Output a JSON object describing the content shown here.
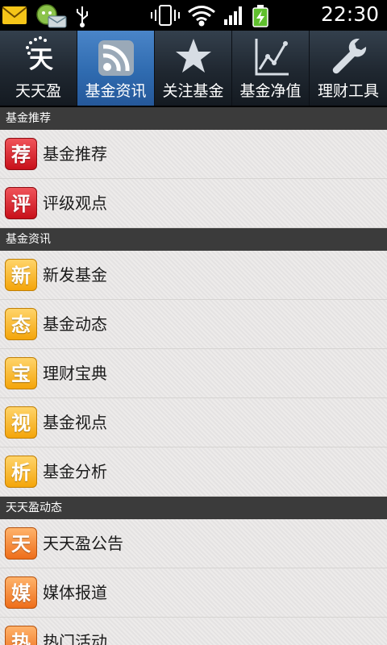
{
  "status_bar": {
    "time": "22:30",
    "left_icons": [
      "mail-icon",
      "chat-notification-icon",
      "usb-icon"
    ],
    "right_icons": [
      "vibrate-icon",
      "wifi-icon",
      "signal-icon",
      "battery-charging-icon"
    ]
  },
  "tabs": [
    {
      "label": "天天盈",
      "icon": "tiantianying-logo-icon",
      "selected": false
    },
    {
      "label": "基金资讯",
      "icon": "rss-feed-icon",
      "selected": true
    },
    {
      "label": "关注基金",
      "icon": "star-icon",
      "selected": false
    },
    {
      "label": "基金净值",
      "icon": "line-chart-icon",
      "selected": false
    },
    {
      "label": "理财工具",
      "icon": "wrench-icon",
      "selected": false
    }
  ],
  "tab_logo_char": "天",
  "sections": [
    {
      "title": "基金推荐",
      "items": [
        {
          "icon_char": "荐",
          "label": "基金推荐",
          "color": "red"
        },
        {
          "icon_char": "评",
          "label": "评级观点",
          "color": "red"
        }
      ]
    },
    {
      "title": "基金资讯",
      "items": [
        {
          "icon_char": "新",
          "label": "新发基金",
          "color": "yellow"
        },
        {
          "icon_char": "态",
          "label": "基金动态",
          "color": "yellow"
        },
        {
          "icon_char": "宝",
          "label": "理财宝典",
          "color": "yellow"
        },
        {
          "icon_char": "视",
          "label": "基金视点",
          "color": "yellow"
        },
        {
          "icon_char": "析",
          "label": "基金分析",
          "color": "yellow"
        }
      ]
    },
    {
      "title": "天天盈动态",
      "items": [
        {
          "icon_char": "天",
          "label": "天天盈公告",
          "color": "orange"
        },
        {
          "icon_char": "媒",
          "label": "媒体报道",
          "color": "orange"
        },
        {
          "icon_char": "热",
          "label": "热门活动",
          "color": "orange"
        }
      ]
    }
  ],
  "colors": {
    "selected_tab": "#3a78bd",
    "tab_bar": "#1f2730",
    "section_header": "#3b3b3b",
    "background": "#e9e7e6"
  }
}
